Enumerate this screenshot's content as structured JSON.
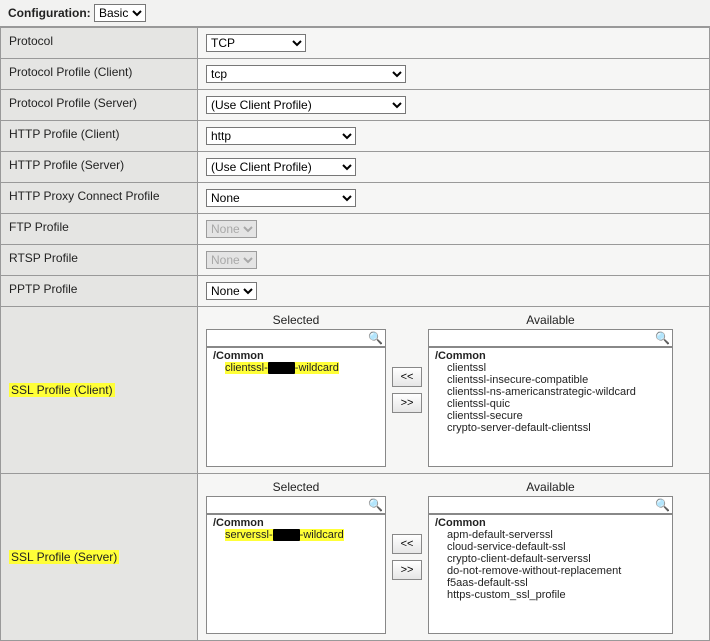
{
  "top": {
    "label": "Configuration:",
    "value": "Basic"
  },
  "rows": {
    "protocol": {
      "label": "Protocol",
      "value": "TCP"
    },
    "pprof_client": {
      "label": "Protocol Profile (Client)",
      "value": "tcp"
    },
    "pprof_server": {
      "label": "Protocol Profile (Server)",
      "value": "(Use Client Profile)"
    },
    "http_client": {
      "label": "HTTP Profile (Client)",
      "value": "http"
    },
    "http_server": {
      "label": "HTTP Profile (Server)",
      "value": "(Use Client Profile)"
    },
    "http_proxy": {
      "label": "HTTP Proxy Connect Profile",
      "value": "None"
    },
    "ftp": {
      "label": "FTP Profile",
      "value": "None"
    },
    "rtsp": {
      "label": "RTSP Profile",
      "value": "None"
    },
    "pptp": {
      "label": "PPTP Profile",
      "value": "None"
    }
  },
  "ssl_client": {
    "label": "SSL Profile (Client)",
    "headers": {
      "selected": "Selected",
      "available": "Available"
    },
    "search_placeholder": "",
    "selected_group": "/Common",
    "selected_item_prefix": "clientssl-",
    "selected_item_suffix": "-wildcard",
    "available_group": "/Common",
    "available_items": [
      "clientssl",
      "clientssl-insecure-compatible",
      "clientssl-ns-americanstrategic-wildcard",
      "clientssl-quic",
      "clientssl-secure",
      "crypto-server-default-clientssl"
    ],
    "btn_left": "<<",
    "btn_right": ">>"
  },
  "ssl_server": {
    "label": "SSL Profile (Server)",
    "headers": {
      "selected": "Selected",
      "available": "Available"
    },
    "search_placeholder": "",
    "selected_group": "/Common",
    "selected_item_prefix": "serverssl-",
    "selected_item_suffix": "-wildcard",
    "available_group": "/Common",
    "available_items": [
      "apm-default-serverssl",
      "cloud-service-default-ssl",
      "crypto-client-default-serverssl",
      "do-not-remove-without-replacement",
      "f5aas-default-ssl",
      "https-custom_ssl_profile"
    ],
    "btn_left": "<<",
    "btn_right": ">>"
  }
}
